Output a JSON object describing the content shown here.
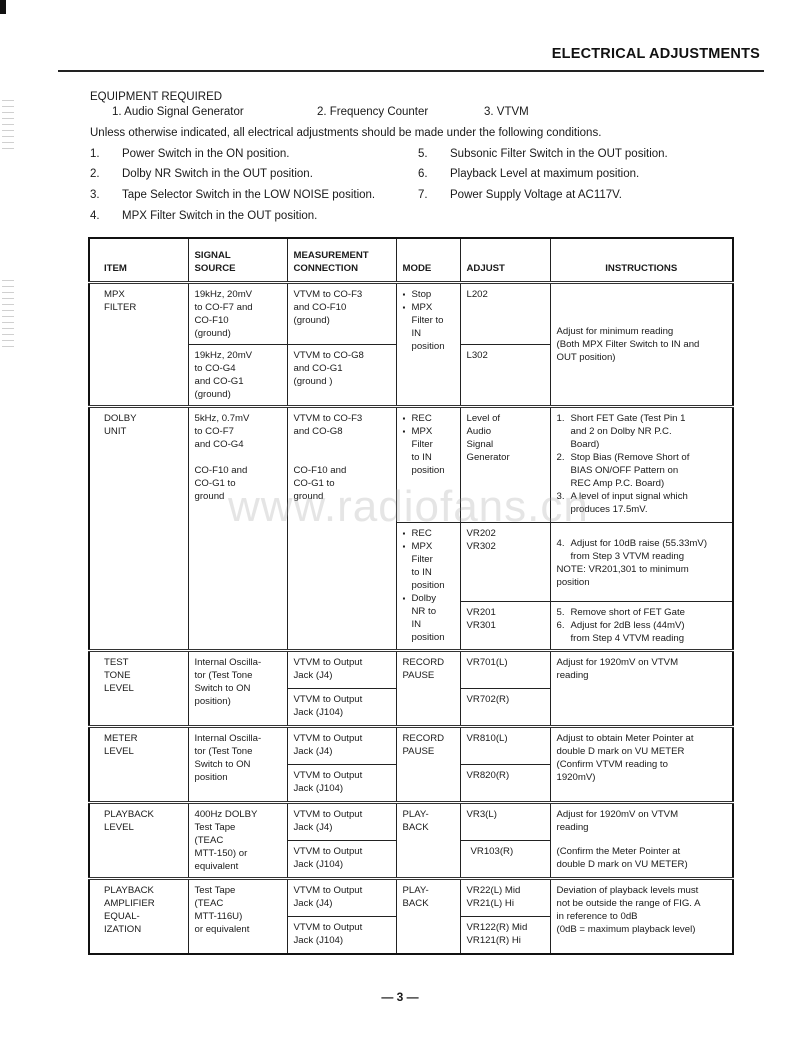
{
  "header": {
    "title": "ELECTRICAL ADJUSTMENTS"
  },
  "equipment": {
    "title": "EQUIPMENT REQUIRED",
    "items": [
      "1.  Audio Signal Generator",
      "2.  Frequency Counter",
      "3.  VTVM"
    ]
  },
  "intro": "Unless otherwise indicated, all electrical adjustments should be made under the following conditions.",
  "conditions": [
    {
      "num": "1.",
      "text": "Power Switch in the ON position."
    },
    {
      "num": "2.",
      "text": "Dolby NR Switch in the OUT position."
    },
    {
      "num": "3.",
      "text": "Tape Selector Switch in the LOW NOISE position."
    },
    {
      "num": "4.",
      "text": "MPX Filter Switch in the OUT position."
    },
    {
      "num": "5.",
      "text": "Subsonic Filter Switch in the OUT position."
    },
    {
      "num": "6.",
      "text": "Playback Level at maximum position."
    },
    {
      "num": "7.",
      "text": "Power Supply Voltage at AC117V."
    }
  ],
  "table": {
    "headers": {
      "item": "ITEM",
      "signal_source": "SIGNAL\nSOURCE",
      "measurement": "MEASUREMENT\nCONNECTION",
      "mode": "MODE",
      "adjust": "ADJUST",
      "instructions": "INSTRUCTIONS"
    },
    "mpx": {
      "item": "MPX\nFILTER",
      "src1": "19kHz, 20mV\nto CO-F7 and\nCO-F10\n(ground)",
      "meas1": "VTVM to CO-F3\nand CO-F10\n(ground)",
      "src2": "19kHz, 20mV\nto CO-G4\nand CO-G1\n(ground)",
      "meas2": "VTVM to CO-G8\nand CO-G1\n(ground )",
      "mode": [
        "Stop",
        "MPX\nFilter to\nIN\nposition"
      ],
      "adj1": "L202",
      "adj2": "L302",
      "instr": "Adjust for minimum reading\n(Both MPX Filter Switch to IN and\nOUT position)"
    },
    "dolby": {
      "item": "DOLBY\nUNIT",
      "src": "5kHz, 0.7mV\nto CO-F7\nand CO-G4\n\nCO-F10 and\nCO-G1 to\nground",
      "meas": "VTVM to CO-F3\nand CO-G8\n\n\nCO-F10 and\nCO-G1 to\nground",
      "mode1": [
        "REC",
        "MPX\nFilter\nto IN\nposition"
      ],
      "mode2": [
        "REC",
        "MPX\nFilter\nto IN\nposition",
        "Dolby\nNR to\nIN\nposition"
      ],
      "adj1": "Level of\nAudio\nSignal\nGenerator",
      "adj2": "VR202\nVR302",
      "adj3": "VR201\nVR301",
      "steps1": [
        {
          "n": "1.",
          "t": "Short FET Gate (Test Pin 1\nand 2 on Dolby NR P.C.\nBoard)"
        },
        {
          "n": "2.",
          "t": "Stop Bias (Remove Short of\nBIAS ON/OFF Pattern on\nREC Amp P.C. Board)"
        },
        {
          "n": "3.",
          "t": "A level of input signal which\nproduces 17.5mV."
        }
      ],
      "steps2": [
        {
          "n": "4.",
          "t": "Adjust for 10dB raise (55.33mV)\nfrom Step 3 VTVM reading"
        }
      ],
      "note": "NOTE: VR201,301 to minimum\nposition",
      "steps3": [
        {
          "n": "5.",
          "t": "Remove short of FET Gate"
        },
        {
          "n": "6.",
          "t": "Adjust for 2dB less (44mV)\nfrom Step 4 VTVM reading"
        }
      ]
    },
    "test_tone": {
      "item": "TEST\nTONE\nLEVEL",
      "src": "Internal Oscilla-\ntor (Test Tone\nSwitch to ON\nposition)",
      "meas1": "VTVM to Output\nJack (J4)",
      "meas2": "VTVM to Output\nJack (J104)",
      "mode": "RECORD\nPAUSE",
      "adj1": "VR701(L)",
      "adj2": "VR702(R)",
      "instr": "Adjust for 1920mV on VTVM\nreading"
    },
    "meter": {
      "item": "METER\nLEVEL",
      "src": "Internal Oscilla-\ntor (Test Tone\nSwitch to ON\nposition",
      "meas1": "VTVM to Output\nJack (J4)",
      "meas2": "VTVM to Output\nJack (J104)",
      "mode": "RECORD\nPAUSE",
      "adj1": "VR810(L)",
      "adj2": "VR820(R)",
      "instr": "Adjust to obtain Meter Pointer at\ndouble D mark on VU METER\n(Confirm VTVM reading to\n1920mV)"
    },
    "playback": {
      "item": "PLAYBACK\nLEVEL",
      "src": "400Hz DOLBY\nTest Tape\n(TEAC\nMTT-150) or\nequivalent",
      "meas1": "VTVM to Output\nJack (J4)",
      "meas2": "VTVM to Output\nJack (J104)",
      "mode": "PLAY-\nBACK",
      "adj1": "VR3(L)",
      "adj2": "VR103(R)",
      "instr1": "Adjust for 1920mV on VTVM\nreading",
      "instr2": "(Confirm the Meter Pointer at\ndouble D mark on VU METER)"
    },
    "eq": {
      "item": "PLAYBACK\nAMPLIFIER\nEQUAL-\nIZATION",
      "src": "Test Tape\n(TEAC\nMTT-116U)\nor equivalent",
      "meas1": "VTVM to Output\nJack (J4)",
      "meas2": "VTVM to Output\nJack (J104)",
      "mode": "PLAY-\nBACK",
      "adj1": "VR22(L) Mid\nVR21(L) Hi",
      "adj2": "VR122(R) Mid\nVR121(R) Hi",
      "instr": "Deviation of playback levels must\nnot be outside the range of FIG. A\nin reference to 0dB\n(0dB = maximum playback level)"
    }
  },
  "watermark": "www.radiofans.cn",
  "page_number": "— 3 —"
}
